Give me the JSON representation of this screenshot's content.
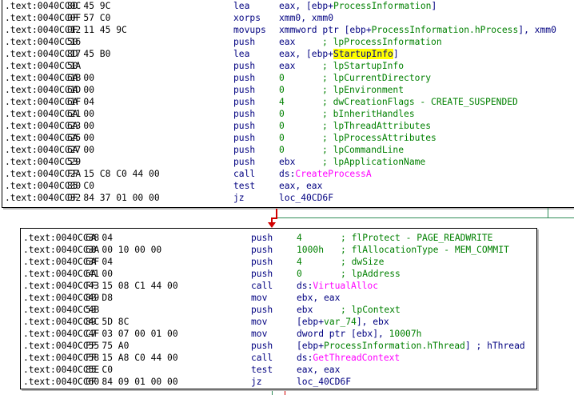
{
  "block1": {
    "rows": [
      {
        "addr": ".text:0040CC0C",
        "bytes": "8D 45 9C",
        "mn": "lea",
        "op": [
          {
            "t": "eax, [ebp+"
          },
          {
            "t": "ProcessInformation",
            "k": "var"
          },
          {
            "t": "]"
          }
        ]
      },
      {
        "addr": ".text:0040CC0F",
        "bytes": "0F 57 C0",
        "mn": "xorps",
        "op": [
          {
            "t": "xmm0, xmm0"
          }
        ]
      },
      {
        "addr": ".text:0040CC12",
        "bytes": "0F 11 45 9C",
        "mn": "movups",
        "op": [
          {
            "t": "xmmword ptr [ebp+"
          },
          {
            "t": "ProcessInformation.hProcess",
            "k": "var"
          },
          {
            "t": "], xmm0"
          }
        ]
      },
      {
        "addr": ".text:0040CC16",
        "bytes": "50",
        "mn": "push",
        "op": [
          {
            "t": "eax"
          }
        ],
        "cm": "; lpProcessInformation"
      },
      {
        "addr": ".text:0040CC17",
        "bytes": "8D 45 B0",
        "mn": "lea",
        "op": [
          {
            "t": "eax, [ebp+"
          },
          {
            "t": "StartupInfo",
            "k": "hl"
          },
          {
            "t": "]"
          }
        ]
      },
      {
        "addr": ".text:0040CC1A",
        "bytes": "50",
        "mn": "push",
        "op": [
          {
            "t": "eax"
          }
        ],
        "cm": "; lpStartupInfo"
      },
      {
        "addr": ".text:0040CC1B",
        "bytes": "6A 00",
        "mn": "push",
        "op": [
          {
            "t": "0",
            "k": "imm"
          }
        ],
        "cm": "; lpCurrentDirectory"
      },
      {
        "addr": ".text:0040CC1D",
        "bytes": "6A 00",
        "mn": "push",
        "op": [
          {
            "t": "0",
            "k": "imm"
          }
        ],
        "cm": "; lpEnvironment"
      },
      {
        "addr": ".text:0040CC1F",
        "bytes": "6A 04",
        "mn": "push",
        "op": [
          {
            "t": "4",
            "k": "imm"
          }
        ],
        "cm": "; dwCreationFlags - CREATE_SUSPENDED"
      },
      {
        "addr": ".text:0040CC21",
        "bytes": "6A 00",
        "mn": "push",
        "op": [
          {
            "t": "0",
            "k": "imm"
          }
        ],
        "cm": "; bInheritHandles"
      },
      {
        "addr": ".text:0040CC23",
        "bytes": "6A 00",
        "mn": "push",
        "op": [
          {
            "t": "0",
            "k": "imm"
          }
        ],
        "cm": "; lpThreadAttributes"
      },
      {
        "addr": ".text:0040CC25",
        "bytes": "6A 00",
        "mn": "push",
        "op": [
          {
            "t": "0",
            "k": "imm"
          }
        ],
        "cm": "; lpProcessAttributes"
      },
      {
        "addr": ".text:0040CC27",
        "bytes": "6A 00",
        "mn": "push",
        "op": [
          {
            "t": "0",
            "k": "imm"
          }
        ],
        "cm": "; lpCommandLine"
      },
      {
        "addr": ".text:0040CC29",
        "bytes": "53",
        "mn": "push",
        "op": [
          {
            "t": "ebx"
          }
        ],
        "cm": "; lpApplicationName"
      },
      {
        "addr": ".text:0040CC2A",
        "bytes": "FF 15 C8 C0 44 00",
        "mn": "call",
        "op": [
          {
            "t": "ds:"
          },
          {
            "t": "CreateProcessA",
            "k": "fn"
          }
        ]
      },
      {
        "addr": ".text:0040CC30",
        "bytes": "85 C0",
        "mn": "test",
        "op": [
          {
            "t": "eax, eax"
          }
        ]
      },
      {
        "addr": ".text:0040CC32",
        "bytes": "0F 84 37 01 00 00",
        "mn": "jz",
        "op": [
          {
            "t": "loc_40CD6F"
          }
        ]
      }
    ]
  },
  "block2": {
    "rows": [
      {
        "addr": ".text:0040CC38",
        "bytes": "6A 04",
        "mn": "push",
        "op": [
          {
            "t": "4",
            "k": "imm"
          }
        ],
        "cm": "; flProtect - PAGE_READWRITE"
      },
      {
        "addr": ".text:0040CC3A",
        "bytes": "68 00 10 00 00",
        "mn": "push",
        "op": [
          {
            "t": "1000h",
            "k": "imm"
          }
        ],
        "cm": "; flAllocationType - MEM_COMMIT"
      },
      {
        "addr": ".text:0040CC3F",
        "bytes": "6A 04",
        "mn": "push",
        "op": [
          {
            "t": "4",
            "k": "imm"
          }
        ],
        "cm": "; dwSize"
      },
      {
        "addr": ".text:0040CC41",
        "bytes": "6A 00",
        "mn": "push",
        "op": [
          {
            "t": "0",
            "k": "imm"
          }
        ],
        "cm": "; lpAddress"
      },
      {
        "addr": ".text:0040CC43",
        "bytes": "FF 15 08 C1 44 00",
        "mn": "call",
        "op": [
          {
            "t": "ds:"
          },
          {
            "t": "VirtualAlloc",
            "k": "fn"
          }
        ]
      },
      {
        "addr": ".text:0040CC49",
        "bytes": "8B D8",
        "mn": "mov",
        "op": [
          {
            "t": "ebx, eax"
          }
        ]
      },
      {
        "addr": ".text:0040CC4B",
        "bytes": "53",
        "mn": "push",
        "op": [
          {
            "t": "ebx"
          }
        ],
        "cm": "; lpContext"
      },
      {
        "addr": ".text:0040CC4C",
        "bytes": "89 5D 8C",
        "mn": "mov",
        "op": [
          {
            "t": "[ebp+"
          },
          {
            "t": "var_74",
            "k": "var"
          },
          {
            "t": "], ebx"
          }
        ]
      },
      {
        "addr": ".text:0040CC4F",
        "bytes": "C7 03 07 00 01 00",
        "mn": "mov",
        "op": [
          {
            "t": "dword ptr [ebx], "
          },
          {
            "t": "10007h",
            "k": "imm"
          }
        ]
      },
      {
        "addr": ".text:0040CC55",
        "bytes": "FF 75 A0",
        "mn": "push",
        "op": [
          {
            "t": "[ebp+"
          },
          {
            "t": "ProcessInformation.hThread",
            "k": "var"
          },
          {
            "t": "] ; hThread"
          }
        ]
      },
      {
        "addr": ".text:0040CC58",
        "bytes": "FF 15 A8 C0 44 00",
        "mn": "call",
        "op": [
          {
            "t": "ds:"
          },
          {
            "t": "GetThreadContext",
            "k": "fn"
          }
        ]
      },
      {
        "addr": ".text:0040CC5E",
        "bytes": "85 C0",
        "mn": "test",
        "op": [
          {
            "t": "eax, eax"
          }
        ]
      },
      {
        "addr": ".text:0040CC60",
        "bytes": "0F 84 09 01 00 00",
        "mn": "jz",
        "op": [
          {
            "t": "loc_40CD6F"
          }
        ]
      }
    ]
  },
  "colors": {
    "false_branch": "#d10000",
    "true_branch": "#2e8b57",
    "highlight": "#ffff00"
  }
}
